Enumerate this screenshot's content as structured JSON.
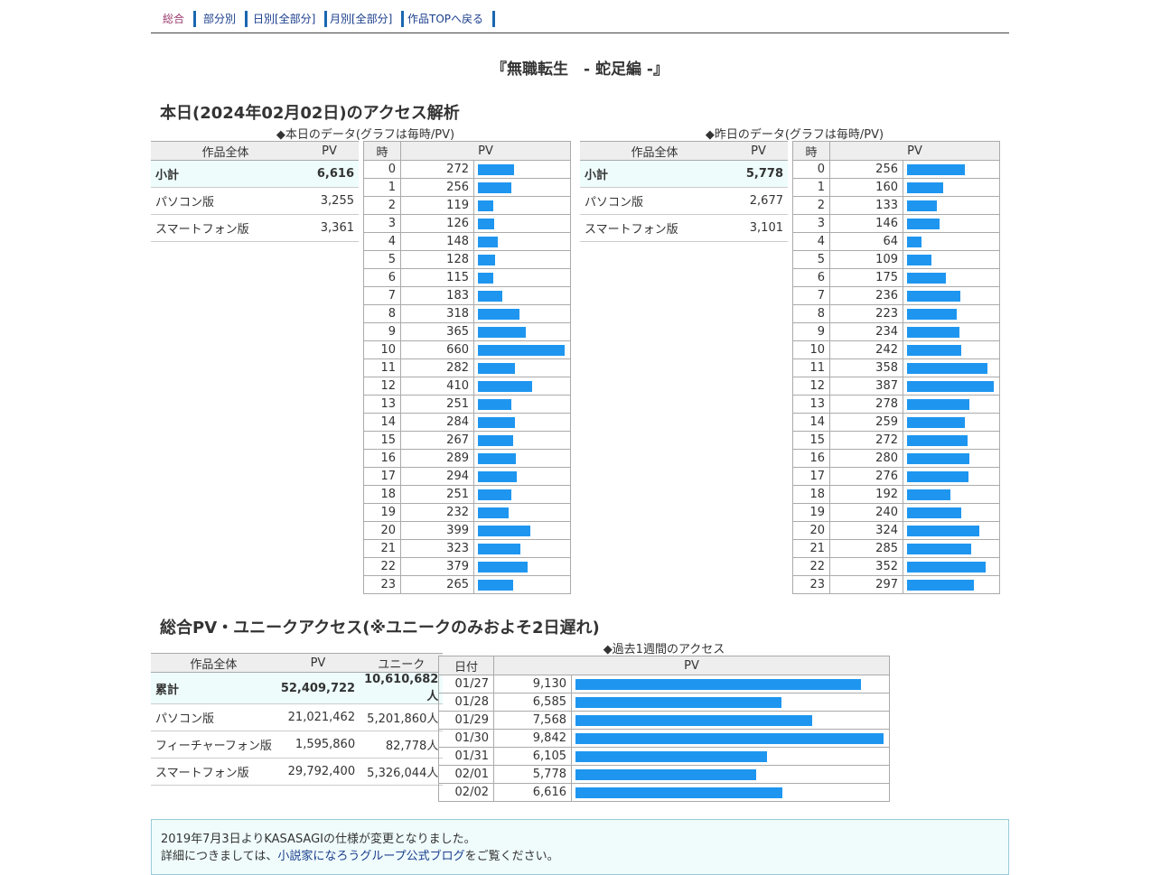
{
  "nav": {
    "items": [
      {
        "label": "総合",
        "current": true
      },
      {
        "label": "部分別",
        "current": false
      },
      {
        "label": "日別[全部分]",
        "current": false
      },
      {
        "label": "月別[全部分]",
        "current": false
      },
      {
        "label": "作品TOPへ戻る",
        "current": false
      }
    ]
  },
  "work_title": "『無職転生　- 蛇足編 -』",
  "today_section": {
    "heading": "本日(2024年02月02日)のアクセス解析",
    "today_caption": "◆本日のデータ(グラフは毎時/PV)",
    "yesterday_caption": "◆昨日のデータ(グラフは毎時/PV)",
    "summary_header": {
      "col1": "作品全体",
      "col2": "PV"
    },
    "hourly_header": {
      "col1": "時",
      "col2": "PV"
    },
    "today_summary": [
      {
        "label": "小計",
        "pv": "6,616"
      },
      {
        "label": "パソコン版",
        "pv": "3,255"
      },
      {
        "label": "スマートフォン版",
        "pv": "3,361"
      }
    ],
    "yesterday_summary": [
      {
        "label": "小計",
        "pv": "5,778"
      },
      {
        "label": "パソコン版",
        "pv": "2,677"
      },
      {
        "label": "スマートフォン版",
        "pv": "3,101"
      }
    ],
    "today_hourly": [
      272,
      256,
      119,
      126,
      148,
      128,
      115,
      183,
      318,
      365,
      660,
      282,
      410,
      251,
      284,
      267,
      289,
      294,
      251,
      232,
      399,
      323,
      379,
      265
    ],
    "yesterday_hourly": [
      256,
      160,
      133,
      146,
      64,
      109,
      175,
      236,
      223,
      234,
      242,
      358,
      387,
      278,
      259,
      272,
      280,
      276,
      192,
      240,
      324,
      285,
      352,
      297
    ]
  },
  "total_section": {
    "heading": "総合PV・ユニークアクセス(※ユニークのみおよそ2日遅れ)",
    "week_caption": "◆過去1週間のアクセス",
    "summary_header": {
      "col1": "作品全体",
      "col2": "PV",
      "col3": "ユニーク"
    },
    "summary": [
      {
        "label": "累計",
        "pv": "52,409,722",
        "unique": "10,610,682人"
      },
      {
        "label": "パソコン版",
        "pv": "21,021,462",
        "unique": "5,201,860人"
      },
      {
        "label": "フィーチャーフォン版",
        "pv": "1,595,860",
        "unique": "82,778人"
      },
      {
        "label": "スマートフォン版",
        "pv": "29,792,400",
        "unique": "5,326,044人"
      }
    ],
    "week_header": {
      "col1": "日付",
      "col2": "PV"
    },
    "week": [
      {
        "date": "01/27",
        "pv": 9130
      },
      {
        "date": "01/28",
        "pv": 6585
      },
      {
        "date": "01/29",
        "pv": 7568
      },
      {
        "date": "01/30",
        "pv": 9842
      },
      {
        "date": "01/31",
        "pv": 6105
      },
      {
        "date": "02/01",
        "pv": 5778
      },
      {
        "date": "02/02",
        "pv": 6616
      }
    ]
  },
  "notice": {
    "line1": "2019年7月3日よりKASASAGIの仕様が変更となりました。",
    "line2_prefix": "詳細につきましては、",
    "line2_link": "小説家になろうグループ公式ブログ",
    "line2_suffix": "をご覧ください。"
  },
  "colors": {
    "bar": "#1e96f0",
    "total_row_bg": "#eefcfc",
    "nav_current": "#9a3c6e",
    "link": "#1a3e8c"
  }
}
